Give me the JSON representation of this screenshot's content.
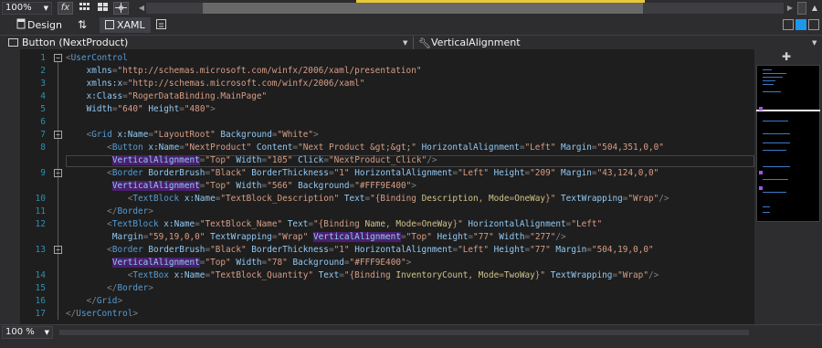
{
  "toolbar": {
    "zoom": "100%",
    "fx_label": "fx"
  },
  "tabs": {
    "design": "Design",
    "swap": "⇅",
    "xaml": "XAML"
  },
  "navbar": {
    "element": "Button (NextProduct)",
    "property": "VerticalAlignment"
  },
  "bottom": {
    "zoom": "100 %"
  },
  "colors": {
    "background": "#1e1e1e",
    "line_number": "#2b91af",
    "element": "#569cd6",
    "attribute": "#92caf4",
    "value": "#d69d85",
    "highlight": "#4a1f6e"
  },
  "code": {
    "line_numbers": [
      "1",
      "2",
      "3",
      "4",
      "5",
      "6",
      "7",
      "8",
      "9",
      "10",
      "11",
      "12",
      "13",
      "14",
      "15",
      "16",
      "17"
    ],
    "lines": [
      "<UserControl",
      "    xmlns=\"http://schemas.microsoft.com/winfx/2006/xaml/presentation\"",
      "    xmlns:x=\"http://schemas.microsoft.com/winfx/2006/xaml\"",
      "    x:Class=\"RogerDataBinding.MainPage\"",
      "    Width=\"640\" Height=\"480\">",
      "",
      "    <Grid x:Name=\"LayoutRoot\" Background=\"White\">",
      "        <Button x:Name=\"NextProduct\" Content=\"Next Product &gt;&gt;\" HorizontalAlignment=\"Left\" Margin=\"504,351,0,0\"",
      "         VerticalAlignment=\"Top\" Width=\"105\" Click=\"NextProduct_Click\"/>",
      "        <Border BorderBrush=\"Black\" BorderThickness=\"1\" HorizontalAlignment=\"Left\" Height=\"209\" Margin=\"43,124,0,0\"",
      "         VerticalAlignment=\"Top\" Width=\"566\" Background=\"#FFF9E400\">",
      "            <TextBlock x:Name=\"TextBlock_Description\" Text=\"{Binding Description, Mode=OneWay}\" TextWrapping=\"Wrap\"/>",
      "        </Border>",
      "        <TextBlock x:Name=\"TextBlock_Name\" Text=\"{Binding Name, Mode=OneWay}\" HorizontalAlignment=\"Left\"",
      "         Margin=\"59,19,0,0\" TextWrapping=\"Wrap\" VerticalAlignment=\"Top\" Height=\"77\" Width=\"277\"/>",
      "        <Border BorderBrush=\"Black\" BorderThickness=\"1\" HorizontalAlignment=\"Left\" Height=\"77\" Margin=\"504,19,0,0\"",
      "         VerticalAlignment=\"Top\" Width=\"78\" Background=\"#FFF9E400\">",
      "            <TextBox x:Name=\"TextBlock_Quantity\" Text=\"{Binding InventoryCount, Mode=TwoWay}\" TextWrapping=\"Wrap\"/>",
      "        </Border>",
      "    </Grid>",
      "</UserControl>"
    ]
  }
}
